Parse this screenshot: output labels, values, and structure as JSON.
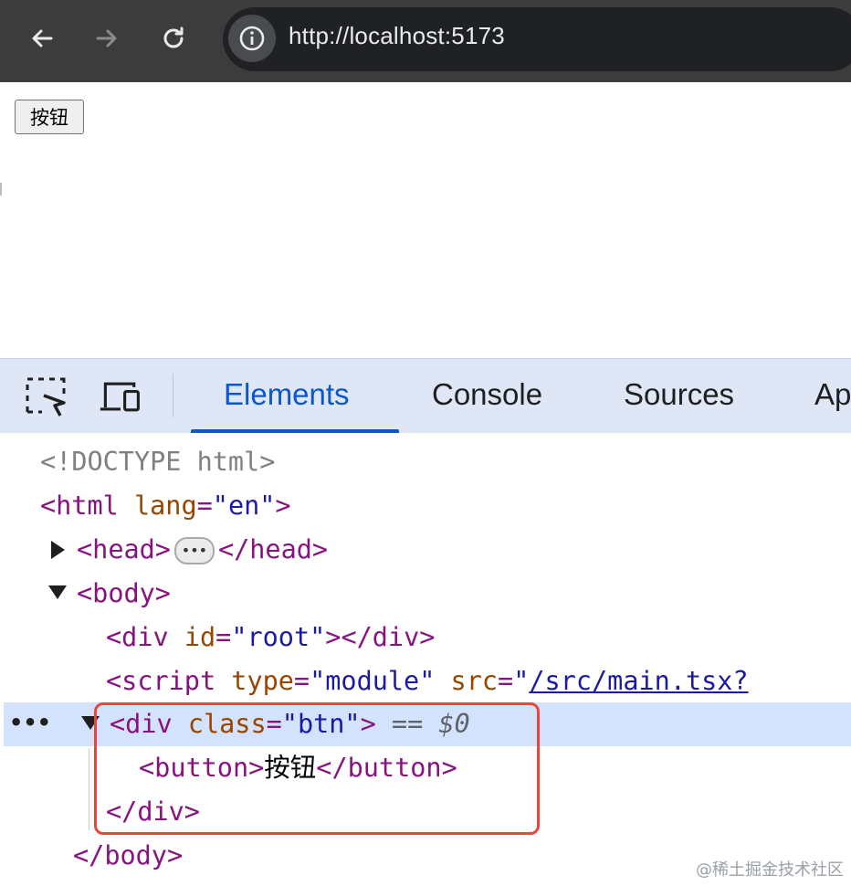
{
  "browser": {
    "url": "http://localhost:5173",
    "back_icon": "arrow-left-icon",
    "forward_icon": "arrow-right-icon",
    "reload_icon": "reload-icon",
    "site_info_icon": "info-circle-icon"
  },
  "page": {
    "button_label": "按钮"
  },
  "devtools": {
    "tabs": [
      "Elements",
      "Console",
      "Sources",
      "Ap"
    ],
    "active_tab": "Elements",
    "inspect_icon": "inspect-element-icon",
    "device_icon": "device-toolbar-icon"
  },
  "dom": {
    "doctype": "<!DOCTYPE html>",
    "html_open": "<html",
    "html_lang_attr": "lang",
    "html_lang_val": "\"en\"",
    "gt": ">",
    "eq": "=",
    "head_open": "<head>",
    "head_close": "</head>",
    "head_ellipsis": "•••",
    "body_open": "<body>",
    "div": "<div",
    "div_close": "</div>",
    "id_attr": "id",
    "id_val": "\"root\"",
    "script_open": "<script",
    "type_attr": "type",
    "type_val": "\"module\"",
    "src_attr": "src",
    "quote": "\"",
    "src_val": "/src/main.tsx?",
    "class_attr": "class",
    "class_val": "\"btn\"",
    "selected_marker": "== $0",
    "row_dots": "•••",
    "button_open": "<button>",
    "button_text": "按钮",
    "button_close": "</button>",
    "body_close": "</body>"
  },
  "watermark": "@稀土掘金技术社区"
}
